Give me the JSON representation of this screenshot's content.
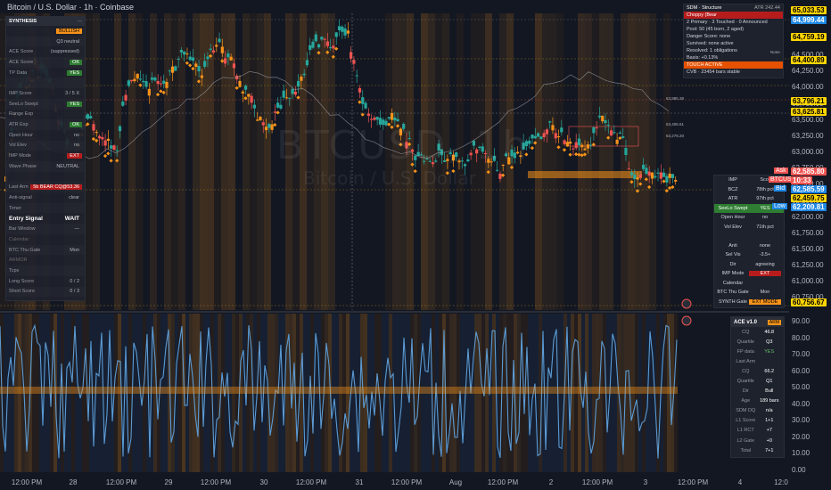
{
  "header": {
    "symbol": "Bitcoin / U.S. Dollar · 1h · Coinbase"
  },
  "watermark": {
    "ticker": "BTCUSD, 1h",
    "name": "Bitcoin / U.S. Dollar"
  },
  "colors": {
    "bg": "#131722",
    "bull": "#26a69a",
    "bear": "#ef5350",
    "orange": "#f7931a",
    "blue": "#5b9bd5",
    "green": "#43a047",
    "red": "#b22222"
  },
  "left_panel": {
    "title": "SYNTHESIS",
    "rows": [
      {
        "label": "",
        "value": "BULLISH",
        "style": "orange"
      },
      {
        "label": "",
        "value": "Q3 neutral",
        "style": "plain"
      },
      {
        "label": "ACE Score",
        "value": "(suppressed)",
        "style": "plain"
      },
      {
        "label": "ACE Score",
        "value": "OK",
        "style": "green"
      },
      {
        "label": "TP Data",
        "value": "YES",
        "style": "green"
      },
      {
        "label": "",
        "value": "",
        "style": "plain"
      },
      {
        "label": "IMP Score",
        "value": "3 / 5 X",
        "style": "plain"
      },
      {
        "label": "SeeLo Swept",
        "value": "YES",
        "style": "green"
      },
      {
        "label": "Range Exp",
        "value": "",
        "style": "plain"
      },
      {
        "label": "ATR Exp",
        "value": "OK",
        "style": "green"
      },
      {
        "label": "Open Hour",
        "value": "no",
        "style": "plain"
      },
      {
        "label": "Vol Elev",
        "value": "no",
        "style": "plain"
      },
      {
        "label": "IMP Mode",
        "value": "EXT",
        "style": "red"
      },
      {
        "label": "Wave Phase",
        "value": "NEUTRAL",
        "style": "plain"
      },
      {
        "label": "",
        "value": "",
        "style": "plain"
      },
      {
        "label": "Last Arm",
        "value": "5b BEAR CQ@53.36",
        "style": "red"
      },
      {
        "label": "Anti-signal",
        "value": "clear",
        "style": "plain"
      },
      {
        "label": "Timer",
        "value": "",
        "style": "plain"
      },
      {
        "label": "Entry Signal",
        "value": "WAIT",
        "style": "big"
      },
      {
        "label": "Bar Window",
        "value": "—",
        "style": "plain"
      },
      {
        "label": "Calendar",
        "value": "",
        "style": "sep"
      },
      {
        "label": "BTC Thu Gate",
        "value": "Mon",
        "style": "plain"
      },
      {
        "label": "ARMOR",
        "value": "",
        "style": "sep"
      },
      {
        "label": "Tcpx",
        "value": "",
        "style": "plain"
      },
      {
        "label": "Long Score",
        "value": "0 / 2",
        "style": "plain"
      },
      {
        "label": "Short Score",
        "value": "0 / 3",
        "style": "plain"
      }
    ]
  },
  "structure_panel": {
    "title": "SDM · Structure",
    "atr": "ATR 242.44",
    "rows": [
      {
        "text": "Choppy (Bear",
        "style": "red"
      },
      {
        "text": "2 Primary · 3 Touched · 0 Announced",
        "style": "plain"
      },
      {
        "text": "Pool: 50 (45 born, 2 aged)",
        "style": "plain"
      },
      {
        "text": "Danger Score: none",
        "style": "plain"
      },
      {
        "text": "Survived: none active",
        "style": "plain"
      },
      {
        "text": "Resolved: 1 obligations",
        "style": "plain"
      },
      {
        "text": "Basis: +0.13%",
        "style": "plain"
      },
      {
        "text": "TOUCH ACTIVE",
        "style": "orange"
      },
      {
        "text": "CVB · 23454 bars stable",
        "style": "plain"
      }
    ],
    "extra": "None"
  },
  "mid_panel": {
    "rows": [
      {
        "label": "IMP",
        "value": "Scor",
        "style": "plain"
      },
      {
        "label": "BCZ",
        "value": "78th pct",
        "style": "plain"
      },
      {
        "label": "ATR",
        "value": "97th pct",
        "style": "plain"
      },
      {
        "label": "SeeLo Swept",
        "value": "YES",
        "style": "green"
      },
      {
        "label": "Open Hour",
        "value": "no",
        "style": "plain"
      },
      {
        "label": "Vol Elev",
        "value": "71th pct",
        "style": "plain"
      },
      {
        "label": "",
        "value": "",
        "style": "plain"
      },
      {
        "label": "Anti",
        "value": "none",
        "style": "plain"
      },
      {
        "label": "Sel Vis",
        "value": "-3.5+",
        "style": "plain"
      },
      {
        "label": "Dir",
        "value": "agreeing",
        "style": "plain"
      },
      {
        "label": "IMP Mode",
        "value": "EXT",
        "style": "red"
      },
      {
        "label": "Calendar",
        "value": "",
        "style": "sep"
      },
      {
        "label": "BTC Thu Gate",
        "value": "Mon",
        "style": "plain"
      },
      {
        "label": "SYNTH Gate",
        "value": "EXT MODE",
        "style": "orange"
      }
    ]
  },
  "price_axis": {
    "labels": [
      "64,750.00",
      "64,500.00",
      "64,250.00",
      "64,000.00",
      "63,750.00",
      "63,500.00",
      "63,250.00",
      "63,000.00",
      "62,750.00",
      "62,500.00",
      "62,250.00",
      "62,000.00",
      "61,750.00",
      "61,500.00",
      "61,250.00",
      "61,000.00",
      "60,750.00"
    ],
    "tags": [
      {
        "text": "65,033.53",
        "style": "yellow"
      },
      {
        "text": "64,999.44",
        "style": "blue"
      },
      {
        "text": "64,759.19",
        "style": "yellow"
      },
      {
        "text": "64,400.89",
        "style": "yellow"
      },
      {
        "text": "63,796.21",
        "style": "yellow"
      },
      {
        "text": "63,625.81",
        "style": "yellow"
      },
      {
        "text": "62,585.59",
        "style": "blue"
      },
      {
        "text": "62,459.75",
        "style": "yellow"
      },
      {
        "text": "62,209.81",
        "style": "blue"
      },
      {
        "text": "60,756.67",
        "style": "yellow"
      }
    ],
    "ask": {
      "label": "Ask",
      "value": "62,585.80"
    },
    "current": {
      "label": "BTCUSD",
      "value": "62,585.80",
      "timer": "10:33"
    },
    "bid": {
      "label": "Bid",
      "value": "62,585.59"
    },
    "low": {
      "label": "Low",
      "value": "62,209.81"
    }
  },
  "ind_axis": {
    "labels": [
      "90.00",
      "80.00",
      "70.00",
      "60.00",
      "50.00",
      "40.00",
      "30.00",
      "20.00",
      "10.00",
      "0.00"
    ]
  },
  "ace_panel": {
    "title": "ACE v1.0",
    "badge": "ARM",
    "rows": [
      {
        "label": "CQ",
        "value": "46.8"
      },
      {
        "label": "Quartile",
        "value": "Q3"
      },
      {
        "label": "FP data",
        "value": "YES"
      },
      {
        "label": "Last Arm",
        "value": ""
      },
      {
        "label": "CQ",
        "value": "66.2"
      },
      {
        "label": "Quartile",
        "value": "Q1"
      },
      {
        "label": "Dir",
        "value": "Bull"
      },
      {
        "label": "Age",
        "value": "189 bars"
      },
      {
        "label": "SDM DQ",
        "value": "n/a"
      },
      {
        "label": "L1 Score",
        "value": "1+1"
      },
      {
        "label": "L1 RCT",
        "value": "+7"
      },
      {
        "label": "L2 Gate",
        "value": "+0"
      },
      {
        "label": "Total",
        "value": "7+1"
      }
    ]
  },
  "structure_refs": [
    "63,985.38",
    "63,405.61",
    "63,278.20"
  ],
  "time_axis": {
    "labels": [
      "12:00 PM",
      "28",
      "12:00 PM",
      "29",
      "12:00 PM",
      "30",
      "12:00 PM",
      "31",
      "12:00 PM",
      "Aug",
      "12:00 PM",
      "2",
      "12:00 PM",
      "3",
      "12:00 PM",
      "4",
      "12:0"
    ]
  }
}
